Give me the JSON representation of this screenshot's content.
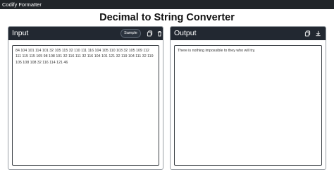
{
  "topbar": {
    "brand": "Codify Formatter"
  },
  "page": {
    "title": "Decimal to String Converter"
  },
  "input_panel": {
    "title": "Input",
    "sample_label": "Sample",
    "icons": [
      "copy-icon",
      "trash-icon"
    ],
    "value": "84 104 101 114 101 32 105 115 32 110 111 116 104 105 110 103 32 105 109 112 111 115 115 105 98 108 101 32 116 111 32 116 104 101 121 32 119 104 111 32 119 105 108 108 32 116 114 121 46"
  },
  "output_panel": {
    "title": "Output",
    "icons": [
      "copy-icon",
      "download-icon"
    ],
    "value": "There is nothing impossible to they who will try."
  }
}
